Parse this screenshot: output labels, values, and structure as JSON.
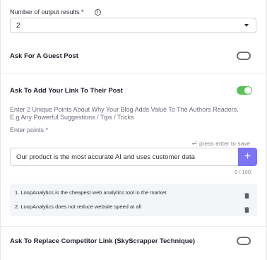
{
  "output_results": {
    "label": "Number of output results *",
    "value": "2"
  },
  "guest_post": {
    "label": "Ask For A Guest Post",
    "enabled": false
  },
  "add_link": {
    "label": "Ask To Add Your Link To Their Post",
    "enabled": true,
    "description_line1": "Enter 2 Unique Points About Why Your Blog Adds Value To The Authors Readers.",
    "description_line2": "E.g Any Powerful Suggestions / Tips / Tricks",
    "points_label": "Enter points *",
    "hint": "press enter to save",
    "input_value": "Our product is the most accurate AI and uses customer data",
    "char_count": "0 / 100",
    "points": [
      {
        "text": "1. LoopAnalytics is the cheapest web analytics tool in the market"
      },
      {
        "text": "2. LoopAnalytics does not reduce website speed at all"
      }
    ]
  },
  "replace_competitor": {
    "label": "Ask To Replace Competitor Link (SkyScrapper Technique)",
    "enabled": false
  },
  "colors": {
    "accent": "#7b75f2",
    "toggle_on": "#58c254"
  }
}
